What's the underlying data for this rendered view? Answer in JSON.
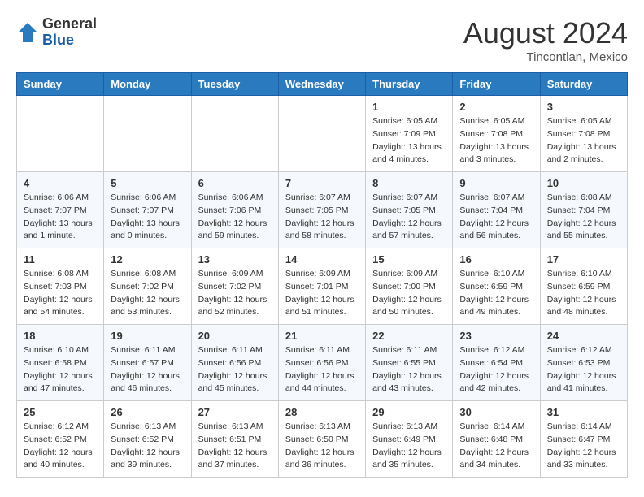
{
  "header": {
    "logo_line1": "General",
    "logo_line2": "Blue",
    "month_year": "August 2024",
    "location": "Tincontlan, Mexico"
  },
  "weekdays": [
    "Sunday",
    "Monday",
    "Tuesday",
    "Wednesday",
    "Thursday",
    "Friday",
    "Saturday"
  ],
  "weeks": [
    [
      {
        "day": "",
        "info": ""
      },
      {
        "day": "",
        "info": ""
      },
      {
        "day": "",
        "info": ""
      },
      {
        "day": "",
        "info": ""
      },
      {
        "day": "1",
        "info": "Sunrise: 6:05 AM\nSunset: 7:09 PM\nDaylight: 13 hours\nand 4 minutes."
      },
      {
        "day": "2",
        "info": "Sunrise: 6:05 AM\nSunset: 7:08 PM\nDaylight: 13 hours\nand 3 minutes."
      },
      {
        "day": "3",
        "info": "Sunrise: 6:05 AM\nSunset: 7:08 PM\nDaylight: 13 hours\nand 2 minutes."
      }
    ],
    [
      {
        "day": "4",
        "info": "Sunrise: 6:06 AM\nSunset: 7:07 PM\nDaylight: 13 hours\nand 1 minute."
      },
      {
        "day": "5",
        "info": "Sunrise: 6:06 AM\nSunset: 7:07 PM\nDaylight: 13 hours\nand 0 minutes."
      },
      {
        "day": "6",
        "info": "Sunrise: 6:06 AM\nSunset: 7:06 PM\nDaylight: 12 hours\nand 59 minutes."
      },
      {
        "day": "7",
        "info": "Sunrise: 6:07 AM\nSunset: 7:05 PM\nDaylight: 12 hours\nand 58 minutes."
      },
      {
        "day": "8",
        "info": "Sunrise: 6:07 AM\nSunset: 7:05 PM\nDaylight: 12 hours\nand 57 minutes."
      },
      {
        "day": "9",
        "info": "Sunrise: 6:07 AM\nSunset: 7:04 PM\nDaylight: 12 hours\nand 56 minutes."
      },
      {
        "day": "10",
        "info": "Sunrise: 6:08 AM\nSunset: 7:04 PM\nDaylight: 12 hours\nand 55 minutes."
      }
    ],
    [
      {
        "day": "11",
        "info": "Sunrise: 6:08 AM\nSunset: 7:03 PM\nDaylight: 12 hours\nand 54 minutes."
      },
      {
        "day": "12",
        "info": "Sunrise: 6:08 AM\nSunset: 7:02 PM\nDaylight: 12 hours\nand 53 minutes."
      },
      {
        "day": "13",
        "info": "Sunrise: 6:09 AM\nSunset: 7:02 PM\nDaylight: 12 hours\nand 52 minutes."
      },
      {
        "day": "14",
        "info": "Sunrise: 6:09 AM\nSunset: 7:01 PM\nDaylight: 12 hours\nand 51 minutes."
      },
      {
        "day": "15",
        "info": "Sunrise: 6:09 AM\nSunset: 7:00 PM\nDaylight: 12 hours\nand 50 minutes."
      },
      {
        "day": "16",
        "info": "Sunrise: 6:10 AM\nSunset: 6:59 PM\nDaylight: 12 hours\nand 49 minutes."
      },
      {
        "day": "17",
        "info": "Sunrise: 6:10 AM\nSunset: 6:59 PM\nDaylight: 12 hours\nand 48 minutes."
      }
    ],
    [
      {
        "day": "18",
        "info": "Sunrise: 6:10 AM\nSunset: 6:58 PM\nDaylight: 12 hours\nand 47 minutes."
      },
      {
        "day": "19",
        "info": "Sunrise: 6:11 AM\nSunset: 6:57 PM\nDaylight: 12 hours\nand 46 minutes."
      },
      {
        "day": "20",
        "info": "Sunrise: 6:11 AM\nSunset: 6:56 PM\nDaylight: 12 hours\nand 45 minutes."
      },
      {
        "day": "21",
        "info": "Sunrise: 6:11 AM\nSunset: 6:56 PM\nDaylight: 12 hours\nand 44 minutes."
      },
      {
        "day": "22",
        "info": "Sunrise: 6:11 AM\nSunset: 6:55 PM\nDaylight: 12 hours\nand 43 minutes."
      },
      {
        "day": "23",
        "info": "Sunrise: 6:12 AM\nSunset: 6:54 PM\nDaylight: 12 hours\nand 42 minutes."
      },
      {
        "day": "24",
        "info": "Sunrise: 6:12 AM\nSunset: 6:53 PM\nDaylight: 12 hours\nand 41 minutes."
      }
    ],
    [
      {
        "day": "25",
        "info": "Sunrise: 6:12 AM\nSunset: 6:52 PM\nDaylight: 12 hours\nand 40 minutes."
      },
      {
        "day": "26",
        "info": "Sunrise: 6:13 AM\nSunset: 6:52 PM\nDaylight: 12 hours\nand 39 minutes."
      },
      {
        "day": "27",
        "info": "Sunrise: 6:13 AM\nSunset: 6:51 PM\nDaylight: 12 hours\nand 37 minutes."
      },
      {
        "day": "28",
        "info": "Sunrise: 6:13 AM\nSunset: 6:50 PM\nDaylight: 12 hours\nand 36 minutes."
      },
      {
        "day": "29",
        "info": "Sunrise: 6:13 AM\nSunset: 6:49 PM\nDaylight: 12 hours\nand 35 minutes."
      },
      {
        "day": "30",
        "info": "Sunrise: 6:14 AM\nSunset: 6:48 PM\nDaylight: 12 hours\nand 34 minutes."
      },
      {
        "day": "31",
        "info": "Sunrise: 6:14 AM\nSunset: 6:47 PM\nDaylight: 12 hours\nand 33 minutes."
      }
    ]
  ]
}
